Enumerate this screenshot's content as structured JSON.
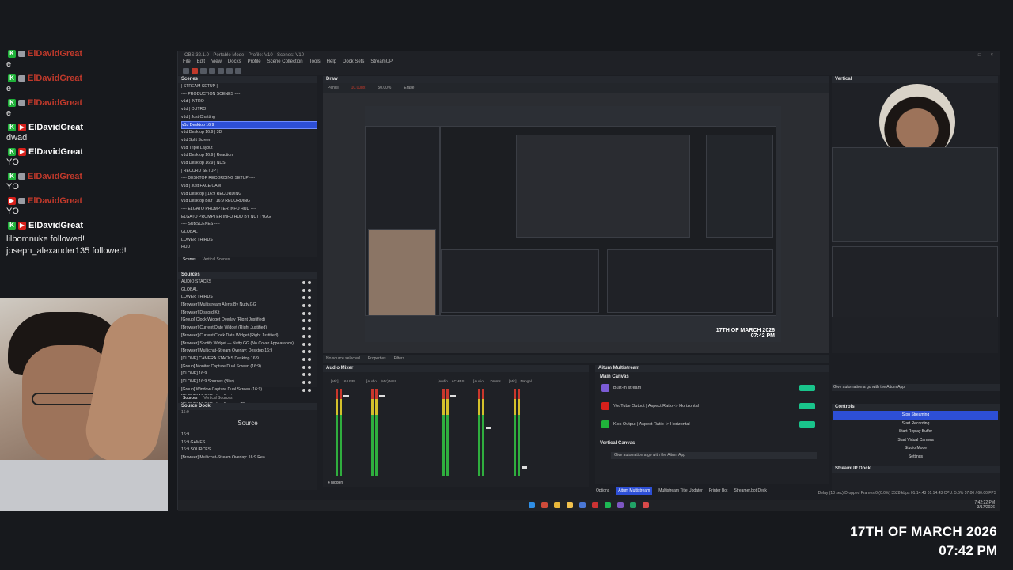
{
  "chat": {
    "messages": [
      {
        "platform": "kick",
        "user": "ElDavidGreat",
        "text": "e",
        "user_color": "#c0392b"
      },
      {
        "platform": "kick",
        "user": "ElDavidGreat",
        "text": "e",
        "user_color": "#c0392b"
      },
      {
        "platform": "kick",
        "user": "ElDavidGreat",
        "text": "e",
        "user_color": "#c0392b"
      },
      {
        "platform": "yt",
        "user": "ElDavidGreat",
        "text": "dwad",
        "user_color": "#ffffff"
      },
      {
        "platform": "yt",
        "user": "ElDavidGreat",
        "text": "YO",
        "user_color": "#ffffff"
      },
      {
        "platform": "kick",
        "user": "ElDavidGreat",
        "text": "YO",
        "user_color": "#c0392b"
      },
      {
        "platform": "yt",
        "user": "ElDavidGreat",
        "text": "YO",
        "user_color": "#c0392b"
      },
      {
        "platform": "yt",
        "user": "ElDavidGreat",
        "text": "",
        "user_color": "#ffffff"
      }
    ],
    "notes": [
      "lilbomnuke followed!",
      "joseph_alexander135 followed!"
    ]
  },
  "obs": {
    "title": "OBS 32.1.0 - Portable Mode - Profile: V10 - Scenes: V10",
    "menu": [
      "File",
      "Edit",
      "View",
      "Docks",
      "Profile",
      "Scene Collection",
      "Tools",
      "Help",
      "Dock Sets",
      "StreamUP"
    ],
    "scenes_header": "Scenes",
    "scenes": [
      "| STREAM SETUP |",
      "---- PRODUCTION SCENES ----",
      "v1d | INTRO",
      "v1d | OUTRO",
      "v1d | Just Chatting",
      "v1d Desktop 16:9",
      "v1d Desktop 16:9 | 3D",
      "v1d Split Screen",
      "v1d Triple Layout",
      "v1d Desktop 16:9 | Reaction",
      "v1d Desktop 16:9 | NDS",
      "| RECORD SETUP |",
      "---- DESKTOP RECORDING SETUP ----",
      "v1d | Just FACE CAM",
      "v1d Desktop | 16:9 RECORDING",
      "v1d Desktop Blur | 16:9 RECORDING",
      "---- ELGATO PROMPTER INFO HUD ----",
      "ELGATO PROMPTER INFO HUD BY NUTTYGG",
      "---- SUBSCENES ----",
      "GLOBAL",
      "LOWER THIRDS",
      "HUD"
    ],
    "selected_scene_index": 5,
    "scene_tabs": [
      "Scenes",
      "Vertical Scenes"
    ],
    "sources_header": "Sources",
    "sources": [
      "AUDIO STACKS",
      "GLOBAL",
      "LOWER THIRDS",
      "[Browser] Multistream Alerts By Nutty.GG",
      "[Browser] Discord Kit",
      "[Group] Clock Widget Overlay (Right Justified)",
      "[Browser] Current Date Widget (Right Justified)",
      "[Browser] Current Clock Date Widget (Right Justified)",
      "[Browser] Spotify Widget — Nutty.GG (No Cover Appearance)",
      "[Browser] Multichat-Stream Overlay: Desktop 16:9",
      "[CLONE] CAMERA STACKS Desktop 16:9",
      "[Group] Monitor Capture Dual Screen (16:9)",
      "[CLONE] 16:9",
      "[CLONE] 16:9 Sources (Blur)",
      "[Group] Window Capture Dual Screen (16:9)",
      "[CLONE] 16:9 Window Capture",
      "[CLONE] 16:9 Window Sources (Blur)"
    ],
    "source_tabs": [
      "Sources",
      "Vertical Sources"
    ],
    "source_dock_header": "Source Dock",
    "source_dock_filter": "16:9",
    "source_dock_title": "Source",
    "source_dock_items": [
      "16:9",
      "16:9 GAMES",
      "16:9 SOURCES",
      "[Browser] Multichat-Stream Overlay: 16:9 Rea"
    ],
    "preview_header": "Draw",
    "draw_tools": [
      "Pencil",
      "10.00px",
      "50.00%",
      "Erase"
    ],
    "vertical_header": "Vertical",
    "mixer_header": "Audio Mixer",
    "mixer_props_label": "No source selected",
    "mixer_tabs": [
      "Properties",
      "Filters"
    ],
    "mixer_channels": [
      "[Mic] ...16 USB",
      "[Audio... (Mic) MSI",
      "[Audio... ACMBS",
      "[Audio... ...Drums",
      "[Mic] ...Nangel"
    ],
    "hidden_label": "4 hidden",
    "aitum_header": "Aitum Multistream",
    "aitum_main_canvas": "Main Canvas",
    "aitum_rows": [
      {
        "label": "Built-in stream",
        "color": "#7b5cd6"
      },
      {
        "label": "YouTube Output | Aspect Ratio -> Horizontal",
        "color": "#d6201b"
      },
      {
        "label": "Kick Output | Aspect Ratio -> Horizontal",
        "color": "#20b23a"
      }
    ],
    "aitum_vertical_canvas": "Vertical Canvas",
    "aitum_prompt": "Give automation a go with the Aitum App",
    "controls_prompt": "Give automation a go with the Aitum App",
    "controls_header": "Controls",
    "controls": [
      "Stop Streaming",
      "Start Recording",
      "Start Replay Buffer",
      "Start Virtual Camera",
      "Studio Mode",
      "Settings"
    ],
    "streamup_header": "StreamUP Dock",
    "bottom_tabs": [
      "Options",
      "Aitum Multistream",
      "Multistream Title Updater",
      "Printer Bot",
      "Streamer.bot Deck"
    ],
    "status": "Delay (10 sec) Dropped Frames 0 (0.0%)   3528 kbps   01:14:43   01:14:43   CPU: 5.6%   57.00 / 60.00 FPS",
    "tray_time": "7:42:22 PM",
    "tray_date": "3/17/2026"
  },
  "preview_overlay_date": {
    "line1": "17TH OF MARCH 2026",
    "line2": "07:42 PM"
  },
  "big_date": {
    "line1": "17TH OF MARCH 2026",
    "line2": "07:42 PM"
  },
  "colors": {
    "accent": "#2d4fd6",
    "toggle_green": "#19c48b",
    "background": "#17191d"
  }
}
